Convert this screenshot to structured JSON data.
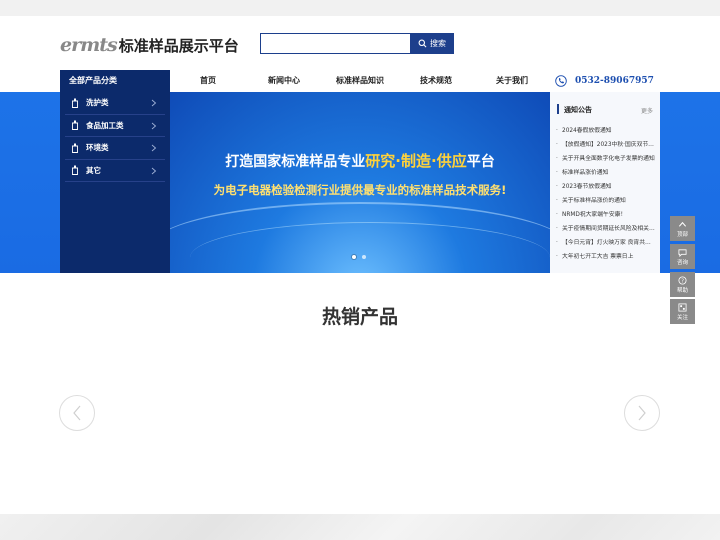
{
  "header": {
    "logo_mark": "ermts",
    "logo_text": "标准样品展示平台",
    "search_placeholder": "",
    "search_button": "搜索"
  },
  "nav": {
    "category_title": "全部产品分类",
    "items": [
      "首页",
      "新闻中心",
      "标准样品知识",
      "技术规范",
      "关于我们"
    ],
    "phone": "0532-89067957"
  },
  "sidebar": {
    "items": [
      {
        "label": "洗护类"
      },
      {
        "label": "食品加工类"
      },
      {
        "label": "环境类"
      },
      {
        "label": "其它"
      }
    ]
  },
  "banner": {
    "slogan_pre": "打造国家标准样品专业",
    "slogan_highlight": "研究·制造·供应",
    "slogan_post": "平台",
    "subslogan": "为电子电器检验检测行业提供最专业的标准样品技术服务!"
  },
  "notice": {
    "title": "通知公告",
    "more": "更多",
    "items": [
      "2024春假放假通知",
      "【放假通知】2023中秋·国庆双节放假通知",
      "关于开具全面数字化电子发票的通知",
      "标准样品涨价通知",
      "2023春节放假通知",
      "关于标准样品涨价的通知",
      "NRMD祝大家端午安康！",
      "关于疫情期间货期延长风险及相关说明",
      "【今日元宵】灯火映万家 良宵共团圆",
      "大年初七开工大吉 票票日上"
    ]
  },
  "section": {
    "hot_title": "热销产品"
  },
  "tools": [
    {
      "label": "顶部",
      "icon": "chevron-up-icon"
    },
    {
      "label": "咨询",
      "icon": "chat-icon"
    },
    {
      "label": "帮助",
      "icon": "help-icon"
    },
    {
      "label": "关注",
      "icon": "qrcode-icon"
    }
  ],
  "colors": {
    "brand_navy": "#0c2a6b",
    "banner_blue": "#1d73e8",
    "highlight_gold": "#ffd23a",
    "phone_blue": "#1d4fb0"
  }
}
